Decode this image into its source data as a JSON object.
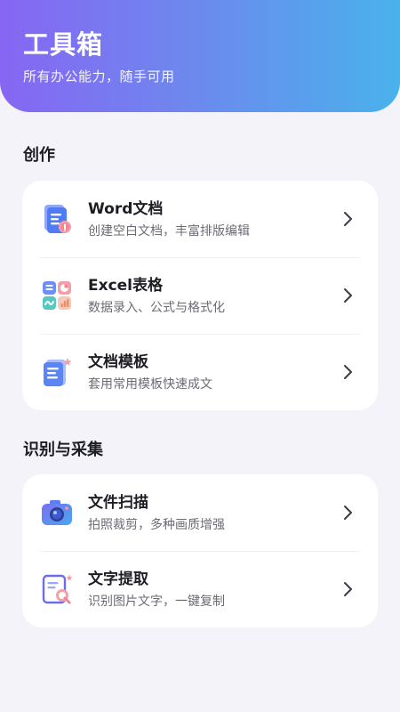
{
  "header": {
    "title": "工具箱",
    "subtitle": "所有办公能力，随手可用"
  },
  "sections": [
    {
      "title": "创作",
      "items": [
        {
          "title": "Word文档",
          "desc": "创建空白文档，丰富排版编辑",
          "icon": "word-document-icon"
        },
        {
          "title": "Excel表格",
          "desc": "数据录入、公式与格式化",
          "icon": "excel-sheet-icon"
        },
        {
          "title": "文档模板",
          "desc": "套用常用模板快速成文",
          "icon": "document-template-icon"
        }
      ]
    },
    {
      "title": "识别与采集",
      "items": [
        {
          "title": "文件扫描",
          "desc": "拍照裁剪，多种画质增强",
          "icon": "camera-scan-icon"
        },
        {
          "title": "文字提取",
          "desc": "识别图片文字，一键复制",
          "icon": "text-extract-icon"
        }
      ]
    }
  ],
  "colors": {
    "header_gradient_start": "#8666f3",
    "header_gradient_end": "#49b2ec",
    "background": "#f4f3fa",
    "card": "#ffffff",
    "accent_blue": "#4f7cf5",
    "accent_pink": "#f4a0a8"
  }
}
